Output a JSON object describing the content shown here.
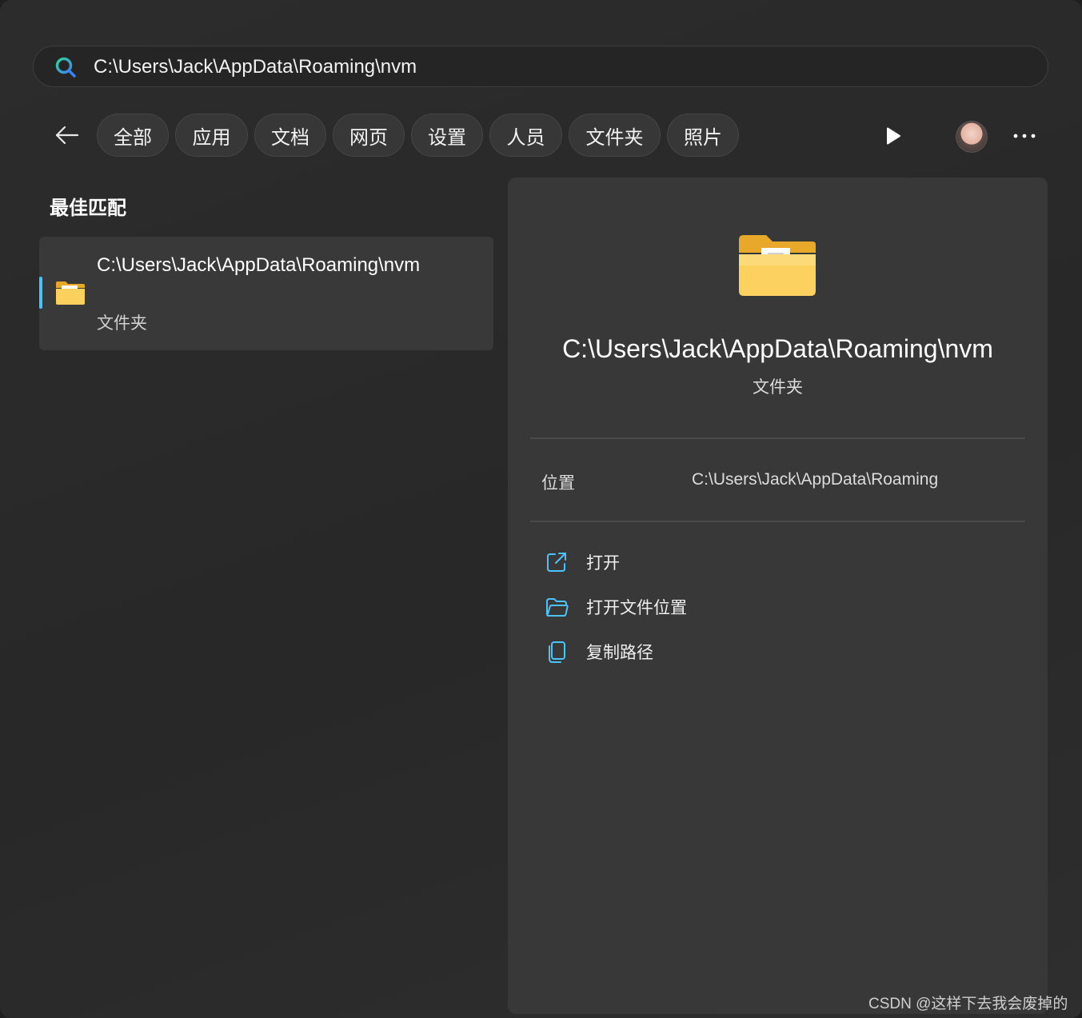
{
  "search": {
    "query": "C:\\Users\\Jack\\AppData\\Roaming\\nvm"
  },
  "filters": [
    "全部",
    "应用",
    "文档",
    "网页",
    "设置",
    "人员",
    "文件夹",
    "照片"
  ],
  "best_match": {
    "heading": "最佳匹配",
    "name": "C:\\Users\\Jack\\AppData\\Roaming\\nvm",
    "type": "文件夹"
  },
  "detail": {
    "title": "C:\\Users\\Jack\\AppData\\Roaming\\nvm",
    "type": "文件夹",
    "location_label": "位置",
    "location_value": "C:\\Users\\Jack\\AppData\\Roaming",
    "actions": [
      {
        "label": "打开",
        "icon": "open-external-icon"
      },
      {
        "label": "打开文件位置",
        "icon": "folder-open-icon"
      },
      {
        "label": "复制路径",
        "icon": "copy-icon"
      }
    ]
  },
  "icons": {
    "search": "search-icon",
    "back": "back-arrow-icon",
    "play": "play-icon",
    "more": "more-icon",
    "folder": "folder-icon"
  },
  "colors": {
    "accent": "#4cc2ff",
    "folder_yellow": "#f8c948"
  },
  "watermark": "CSDN @这样下去我会废掉的"
}
